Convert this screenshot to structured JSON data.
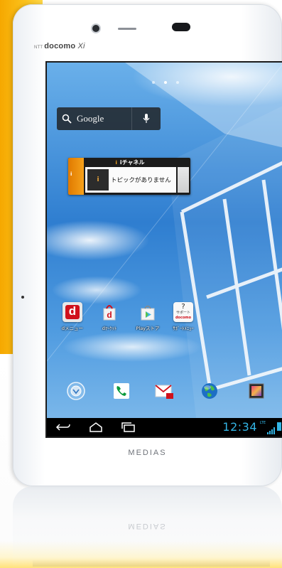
{
  "device": {
    "carrier_prefix": "NTT",
    "carrier": "docomo",
    "carrier_suffix": "Xi",
    "maker": "MEDIAS"
  },
  "home": {
    "page_count": 3,
    "active_page": 1
  },
  "google_widget": {
    "label": "Google",
    "search_icon": "search-icon",
    "mic_icon": "mic-icon"
  },
  "ichannel_widget": {
    "tab_logo": "i",
    "header_mini": "i",
    "header": "iチャネル",
    "logo": "i",
    "message": "トピックがありません"
  },
  "apps": [
    {
      "label": "dメニュー",
      "icon": "dmenu-icon"
    },
    {
      "label": "dﾏｰｹｯﾄ",
      "icon": "dmarket-icon"
    },
    {
      "label": "Playストア",
      "icon": "play-store-icon"
    },
    {
      "label": "ｻﾎﾟｰﾄﾒﾆｭｰ",
      "icon": "support-icon",
      "icon_text_top": "?",
      "icon_text_mid": "サポート",
      "icon_text_brand": "docomo"
    }
  ],
  "dock": [
    {
      "name": "app-drawer",
      "icon": "app-drawer-icon"
    },
    {
      "name": "phone",
      "icon": "phone-icon"
    },
    {
      "name": "mail",
      "icon": "mail-icon"
    },
    {
      "name": "browser",
      "icon": "globe-icon"
    },
    {
      "name": "gallery",
      "icon": "gallery-icon"
    }
  ],
  "navbar": {
    "back_icon": "back-icon",
    "home_icon": "home-icon",
    "recent_icon": "recent-apps-icon"
  },
  "status": {
    "time": "12:34",
    "network": "LTE",
    "accent_color": "#33b5e5"
  }
}
